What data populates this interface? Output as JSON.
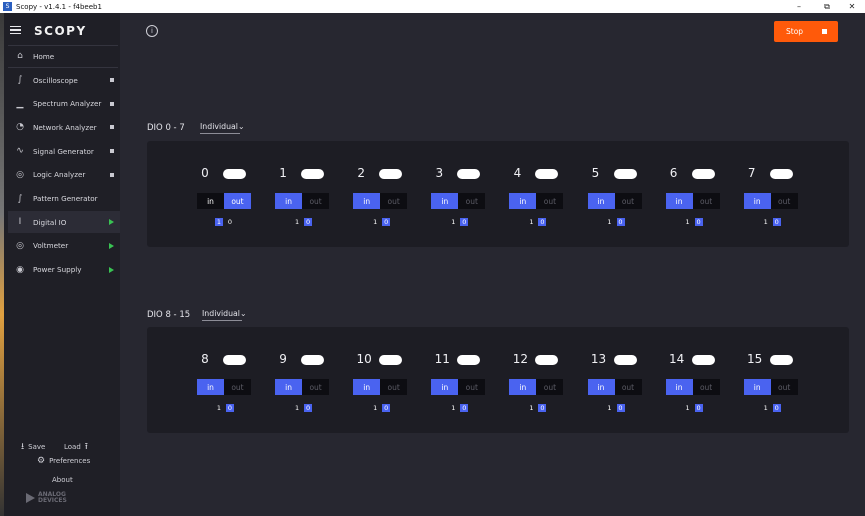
{
  "window": {
    "title": "Scopy - v1.4.1 - f4beeb1",
    "app_icon": "scopy-app-icon",
    "minimize": "–",
    "restore": "⧉",
    "close": "✕"
  },
  "sidebar": {
    "logo": "SCOPY",
    "home": "Home",
    "items": [
      {
        "label": "Oscilloscope",
        "icon": "oscilloscope-icon",
        "indicator": "square"
      },
      {
        "label": "Spectrum Analyzer",
        "icon": "spectrum-analyzer-icon",
        "indicator": "square"
      },
      {
        "label": "Network Analyzer",
        "icon": "network-analyzer-icon",
        "indicator": "square"
      },
      {
        "label": "Signal Generator",
        "icon": "signal-generator-icon",
        "indicator": "square"
      },
      {
        "label": "Logic Analyzer",
        "icon": "logic-analyzer-icon",
        "indicator": "square"
      },
      {
        "label": "Pattern Generator",
        "icon": "pattern-generator-icon",
        "indicator": "none"
      },
      {
        "label": "Digital IO",
        "icon": "digital-io-icon",
        "indicator": "play"
      },
      {
        "label": "Voltmeter",
        "icon": "voltmeter-icon",
        "indicator": "play"
      },
      {
        "label": "Power Supply",
        "icon": "power-supply-icon",
        "indicator": "play"
      }
    ],
    "save": "Save",
    "load": "Load",
    "preferences": "Preferences",
    "about": "About",
    "brand_line1": "ANALOG",
    "brand_line2": "DEVICES"
  },
  "toolbar": {
    "stop_label": "Stop"
  },
  "groups": [
    {
      "title": "DIO 0 - 7",
      "mode": "Individual",
      "channels": [
        {
          "number": "0",
          "in_label": "in",
          "out_label": "out",
          "direction": "out",
          "level_high": "1",
          "level_low": "0",
          "value": "1"
        },
        {
          "number": "1",
          "in_label": "in",
          "out_label": "out",
          "direction": "in",
          "level_high": "1",
          "level_low": "0",
          "value": "0"
        },
        {
          "number": "2",
          "in_label": "in",
          "out_label": "out",
          "direction": "in",
          "level_high": "1",
          "level_low": "0",
          "value": "0"
        },
        {
          "number": "3",
          "in_label": "in",
          "out_label": "out",
          "direction": "in",
          "level_high": "1",
          "level_low": "0",
          "value": "0"
        },
        {
          "number": "4",
          "in_label": "in",
          "out_label": "out",
          "direction": "in",
          "level_high": "1",
          "level_low": "0",
          "value": "0"
        },
        {
          "number": "5",
          "in_label": "in",
          "out_label": "out",
          "direction": "in",
          "level_high": "1",
          "level_low": "0",
          "value": "0"
        },
        {
          "number": "6",
          "in_label": "in",
          "out_label": "out",
          "direction": "in",
          "level_high": "1",
          "level_low": "0",
          "value": "0"
        },
        {
          "number": "7",
          "in_label": "in",
          "out_label": "out",
          "direction": "in",
          "level_high": "1",
          "level_low": "0",
          "value": "0"
        }
      ]
    },
    {
      "title": "DIO 8 - 15",
      "mode": "Individual",
      "channels": [
        {
          "number": "8",
          "in_label": "in",
          "out_label": "out",
          "direction": "in",
          "level_high": "1",
          "level_low": "0",
          "value": "0"
        },
        {
          "number": "9",
          "in_label": "in",
          "out_label": "out",
          "direction": "in",
          "level_high": "1",
          "level_low": "0",
          "value": "0"
        },
        {
          "number": "10",
          "in_label": "in",
          "out_label": "out",
          "direction": "in",
          "level_high": "1",
          "level_low": "0",
          "value": "0"
        },
        {
          "number": "11",
          "in_label": "in",
          "out_label": "out",
          "direction": "in",
          "level_high": "1",
          "level_low": "0",
          "value": "0"
        },
        {
          "number": "12",
          "in_label": "in",
          "out_label": "out",
          "direction": "in",
          "level_high": "1",
          "level_low": "0",
          "value": "0"
        },
        {
          "number": "13",
          "in_label": "in",
          "out_label": "out",
          "direction": "in",
          "level_high": "1",
          "level_low": "0",
          "value": "0"
        },
        {
          "number": "14",
          "in_label": "in",
          "out_label": "out",
          "direction": "in",
          "level_high": "1",
          "level_low": "0",
          "value": "0"
        },
        {
          "number": "15",
          "in_label": "in",
          "out_label": "out",
          "direction": "in",
          "level_high": "1",
          "level_low": "0",
          "value": "0"
        }
      ]
    }
  ],
  "colors": {
    "accent": "#4a63f0",
    "stop": "#ff5a0a",
    "sidebar": "#1f1f26",
    "panel": "#1d1d24",
    "background": "#272730",
    "active_indicator": "#39c353"
  }
}
